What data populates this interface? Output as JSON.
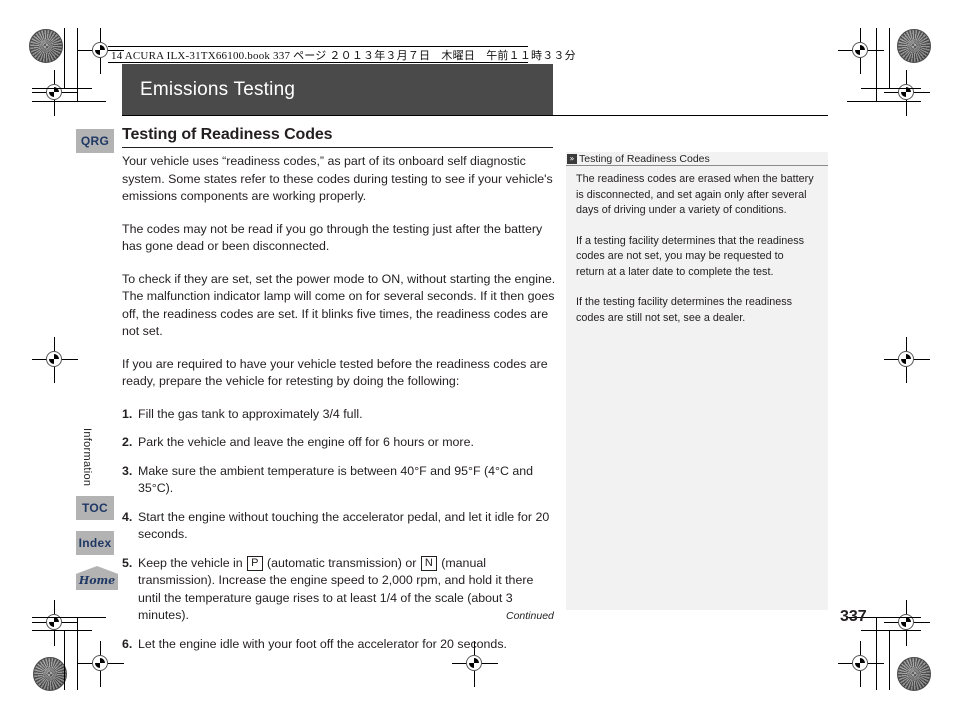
{
  "print_meta": {
    "line": "14 ACURA ILX-31TX66100.book  337 ページ  ２０１３年３月７日　木曜日　午前１１時３３分"
  },
  "chapter": {
    "title": "Emissions Testing"
  },
  "nav": {
    "qrg_label": "QRG",
    "section_label": "Information",
    "toc_label": "TOC",
    "index_label": "Index",
    "home_label": "Home"
  },
  "content": {
    "heading": "Testing of Readiness Codes",
    "paragraphs": [
      "Your vehicle uses “readiness codes,” as part of its onboard self diagnostic system. Some states refer to these codes during testing to see if your vehicle's emissions components are working properly.",
      "The codes may not be read if you go through the testing just after the battery has gone dead or been disconnected.",
      "To check if they are set, set the power mode to ON, without starting the engine. The malfunction indicator lamp will come on for several seconds. If it then goes off, the readiness codes are set. If it blinks five times, the readiness codes are not set.",
      "If you are required to have your vehicle tested before the readiness codes are ready, prepare the vehicle for retesting by doing the following:"
    ],
    "steps": [
      {
        "num": "1.",
        "text": "Fill the gas tank to approximately 3/4 full."
      },
      {
        "num": "2.",
        "text": "Park the vehicle and leave the engine off for 6 hours or more."
      },
      {
        "num": "3.",
        "text": "Make sure the ambient temperature is between 40°F and 95°F (4°C and 35°C)."
      },
      {
        "num": "4.",
        "text": "Start the engine without touching the accelerator pedal, and let it idle for 20 seconds."
      },
      {
        "num": "5.",
        "text_a": "Keep the vehicle in ",
        "gear_auto": "P",
        "text_b": " (automatic transmission) or ",
        "gear_manual": "N",
        "text_c": " (manual transmission). Increase the engine speed to 2,000 rpm, and hold it there until the temperature gauge rises to at least 1/4 of the scale (about 3 minutes)."
      },
      {
        "num": "6.",
        "text": "Let the engine idle with your foot off the accelerator for 20 seconds."
      }
    ]
  },
  "side_panel": {
    "marker": "»",
    "title": "Testing of Readiness Codes",
    "paragraphs": [
      "The readiness codes are erased when the battery is disconnected, and set again only after several days of driving under a variety of conditions.",
      "If a testing facility determines that the readiness codes are not set, you may be requested to return at a later date to complete the test.",
      "If the testing facility determines the readiness codes are still not set, see a dealer."
    ]
  },
  "footer": {
    "continued": "Continued",
    "page_number": "337"
  },
  "colors": {
    "title_band": "#4a4a4a",
    "nav_tab_bg": "#b3b3b3",
    "nav_tab_text": "#1f3864",
    "side_panel_bg": "#f2f2f2"
  }
}
